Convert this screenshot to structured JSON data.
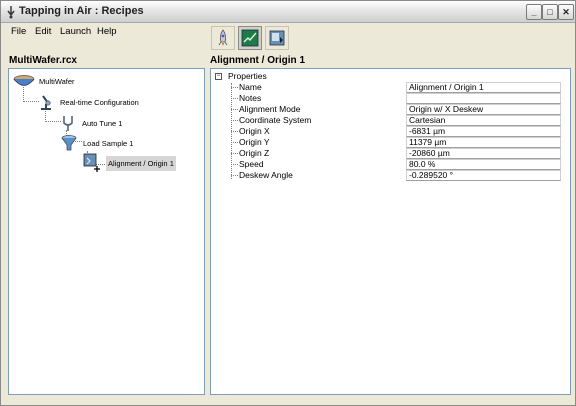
{
  "window": {
    "title": "Tapping in Air : Recipes",
    "minimize_glyph": "_",
    "maximize_glyph": "□",
    "close_glyph": "✕"
  },
  "menu": {
    "items": [
      "File",
      "Edit",
      "Launch",
      "Help"
    ]
  },
  "toolbar": {
    "icons": [
      "rocket-icon",
      "chart-icon",
      "recipe-icon"
    ]
  },
  "left_pane": {
    "title": "MultiWafer.rcx",
    "tree": [
      {
        "label": "MultiWafer",
        "icon": "bowl-icon"
      },
      {
        "label": "Real-time Configuration",
        "icon": "microscope-icon"
      },
      {
        "label": "Auto Tune 1",
        "icon": "tuning-fork-icon"
      },
      {
        "label": "Load Sample 1",
        "icon": "funnel-icon"
      },
      {
        "label": "Alignment / Origin 1",
        "icon": "alignment-icon"
      }
    ]
  },
  "right_pane": {
    "title": "Alignment / Origin 1",
    "root_label": "Properties",
    "expander": "⊟",
    "properties": [
      {
        "name": "Name",
        "value": "Alignment / Origin 1"
      },
      {
        "name": "Notes",
        "value": ""
      },
      {
        "name": "Alignment Mode",
        "value": "Origin w/ X Deskew"
      },
      {
        "name": "Coordinate System",
        "value": "Cartesian"
      },
      {
        "name": "Origin X",
        "value": "-6831 µm"
      },
      {
        "name": "Origin Y",
        "value": "11379 µm"
      },
      {
        "name": "Origin Z",
        "value": "-20860 µm"
      },
      {
        "name": "Speed",
        "value": "80.0 %"
      },
      {
        "name": "Deskew Angle",
        "value": "-0.289520 °"
      }
    ]
  }
}
